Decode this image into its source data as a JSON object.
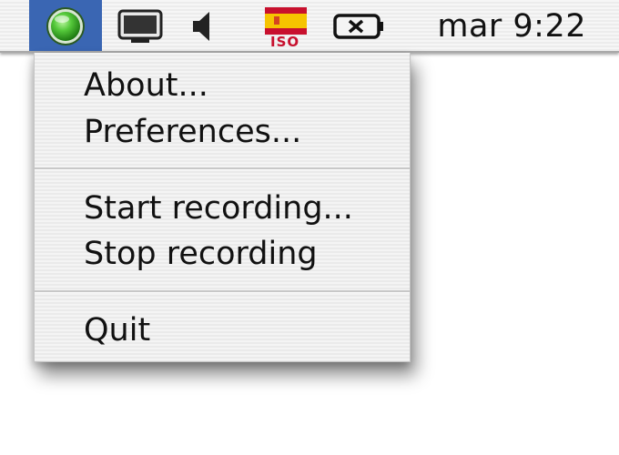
{
  "menubar": {
    "extras": [
      {
        "name": "status-light-icon",
        "color": "#3bb42a",
        "selected": true
      },
      {
        "name": "display-icon"
      },
      {
        "name": "volume-icon"
      },
      {
        "name": "flag-spain-icon",
        "label": "ISO"
      },
      {
        "name": "battery-icon"
      }
    ],
    "clock": "mar 9:22",
    "selected_color": "#3a66b3"
  },
  "menu": {
    "items": [
      {
        "label": "About..."
      },
      {
        "label": "Preferences..."
      },
      {
        "label": "Start recording..."
      },
      {
        "label": "Stop recording"
      },
      {
        "label": "Quit"
      }
    ]
  }
}
